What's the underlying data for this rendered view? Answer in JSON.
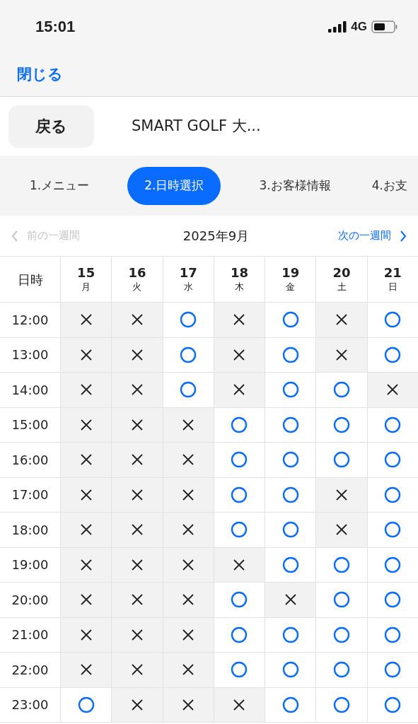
{
  "status_bar": {
    "time": "15:01",
    "network": "4G"
  },
  "nav": {
    "close": "閉じる"
  },
  "header": {
    "back": "戻る",
    "title": "SMART GOLF 大..."
  },
  "steps": [
    {
      "label": "1.メニュー",
      "selected": false
    },
    {
      "label": "2.日時選択",
      "selected": true
    },
    {
      "label": "3.お客様情報",
      "selected": false
    },
    {
      "label": "4.お支",
      "selected": false
    }
  ],
  "week_nav": {
    "prev": {
      "label": "前の一週間",
      "disabled": true
    },
    "month": "2025年9月",
    "next": {
      "label": "次の一週間",
      "disabled": false
    }
  },
  "table": {
    "corner": "日時",
    "days": [
      {
        "date": "15",
        "weekday": "月"
      },
      {
        "date": "16",
        "weekday": "火"
      },
      {
        "date": "17",
        "weekday": "水"
      },
      {
        "date": "18",
        "weekday": "木"
      },
      {
        "date": "19",
        "weekday": "金"
      },
      {
        "date": "20",
        "weekday": "土"
      },
      {
        "date": "21",
        "weekday": "日"
      }
    ],
    "rows": [
      {
        "time": "12:00",
        "slots": [
          false,
          false,
          true,
          false,
          true,
          false,
          true
        ]
      },
      {
        "time": "13:00",
        "slots": [
          false,
          false,
          true,
          false,
          true,
          false,
          true
        ]
      },
      {
        "time": "14:00",
        "slots": [
          false,
          false,
          true,
          false,
          true,
          true,
          false
        ]
      },
      {
        "time": "15:00",
        "slots": [
          false,
          false,
          false,
          true,
          true,
          true,
          true
        ]
      },
      {
        "time": "16:00",
        "slots": [
          false,
          false,
          false,
          true,
          true,
          true,
          true
        ]
      },
      {
        "time": "17:00",
        "slots": [
          false,
          false,
          false,
          true,
          true,
          false,
          true
        ]
      },
      {
        "time": "18:00",
        "slots": [
          false,
          false,
          false,
          true,
          true,
          false,
          true
        ]
      },
      {
        "time": "19:00",
        "slots": [
          false,
          false,
          false,
          false,
          true,
          true,
          true
        ]
      },
      {
        "time": "20:00",
        "slots": [
          false,
          false,
          false,
          true,
          false,
          true,
          true
        ]
      },
      {
        "time": "21:00",
        "slots": [
          false,
          false,
          false,
          true,
          true,
          true,
          true
        ]
      },
      {
        "time": "22:00",
        "slots": [
          false,
          false,
          false,
          true,
          true,
          true,
          true
        ]
      },
      {
        "time": "23:00",
        "slots": [
          true,
          false,
          false,
          false,
          true,
          true,
          true
        ]
      }
    ]
  }
}
